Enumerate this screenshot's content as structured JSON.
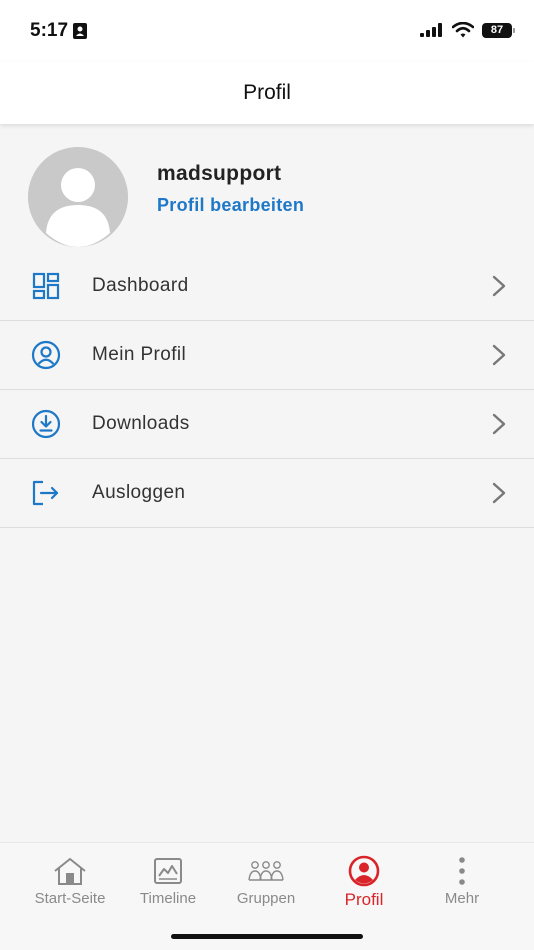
{
  "status_bar": {
    "time": "5:17",
    "battery": "87"
  },
  "header": {
    "title": "Profil"
  },
  "profile": {
    "username": "madsupport",
    "edit_label": "Profil bearbeiten"
  },
  "menu": {
    "items": [
      {
        "label": "Dashboard",
        "icon": "dashboard-icon"
      },
      {
        "label": "Mein Profil",
        "icon": "user-circle-icon"
      },
      {
        "label": "Downloads",
        "icon": "download-circle-icon"
      },
      {
        "label": "Ausloggen",
        "icon": "logout-icon"
      }
    ]
  },
  "bottom_nav": {
    "items": [
      {
        "label": "Start-Seite",
        "icon": "home-icon",
        "active": false
      },
      {
        "label": "Timeline",
        "icon": "timeline-icon",
        "active": false
      },
      {
        "label": "Gruppen",
        "icon": "groups-icon",
        "active": false
      },
      {
        "label": "Profil",
        "icon": "profile-icon",
        "active": true
      },
      {
        "label": "Mehr",
        "icon": "more-icon",
        "active": false
      }
    ]
  },
  "colors": {
    "accent_blue": "#1e78c8",
    "active_red": "#d9252a",
    "inactive_gray": "#8a8a8a"
  }
}
